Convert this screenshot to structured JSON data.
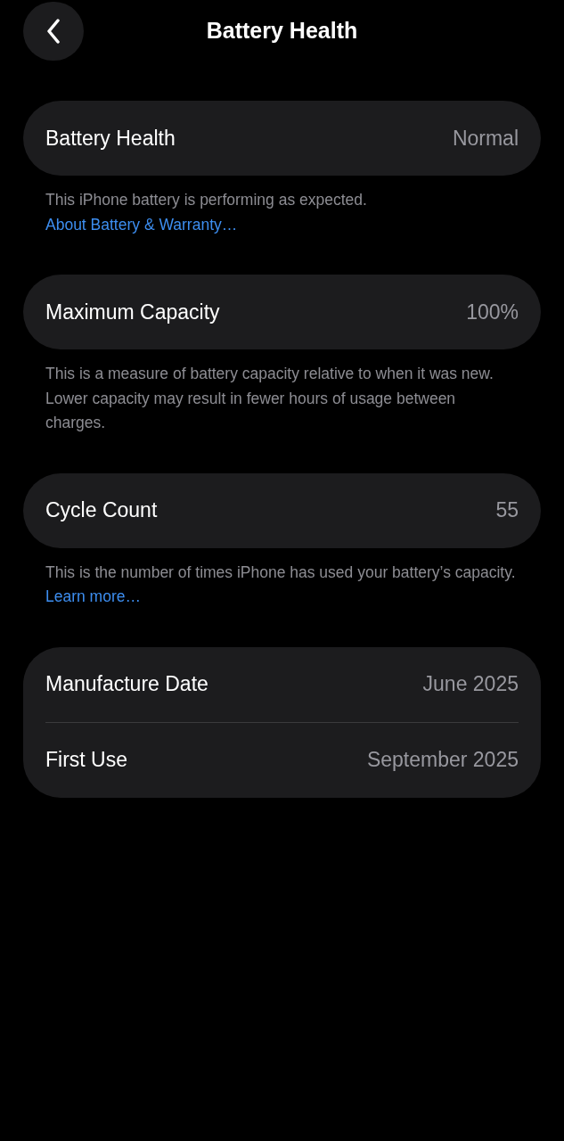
{
  "nav": {
    "title": "Battery Health"
  },
  "sections": [
    {
      "rows": [
        {
          "label": "Battery Health",
          "value": "Normal"
        }
      ],
      "footer": [
        {
          "kind": "text",
          "text": "This iPhone battery is performing as expected. "
        },
        {
          "kind": "link",
          "text": "About Battery & Warranty…"
        }
      ]
    },
    {
      "rows": [
        {
          "label": "Maximum Capacity",
          "value": "100%"
        }
      ],
      "footer": [
        {
          "kind": "text",
          "text": "This is a measure of battery capacity relative to when it was new. Lower capacity may result in fewer hours of usage between charges."
        }
      ]
    },
    {
      "rows": [
        {
          "label": "Cycle Count",
          "value": "55"
        }
      ],
      "footer": [
        {
          "kind": "text",
          "text": "This is the number of times iPhone has used your battery’s capacity. "
        },
        {
          "kind": "link",
          "text": "Learn more…"
        }
      ]
    },
    {
      "rows": [
        {
          "label": "Manufacture Date",
          "value": "June 2025"
        },
        {
          "label": "First Use",
          "value": "September 2025"
        }
      ]
    }
  ]
}
